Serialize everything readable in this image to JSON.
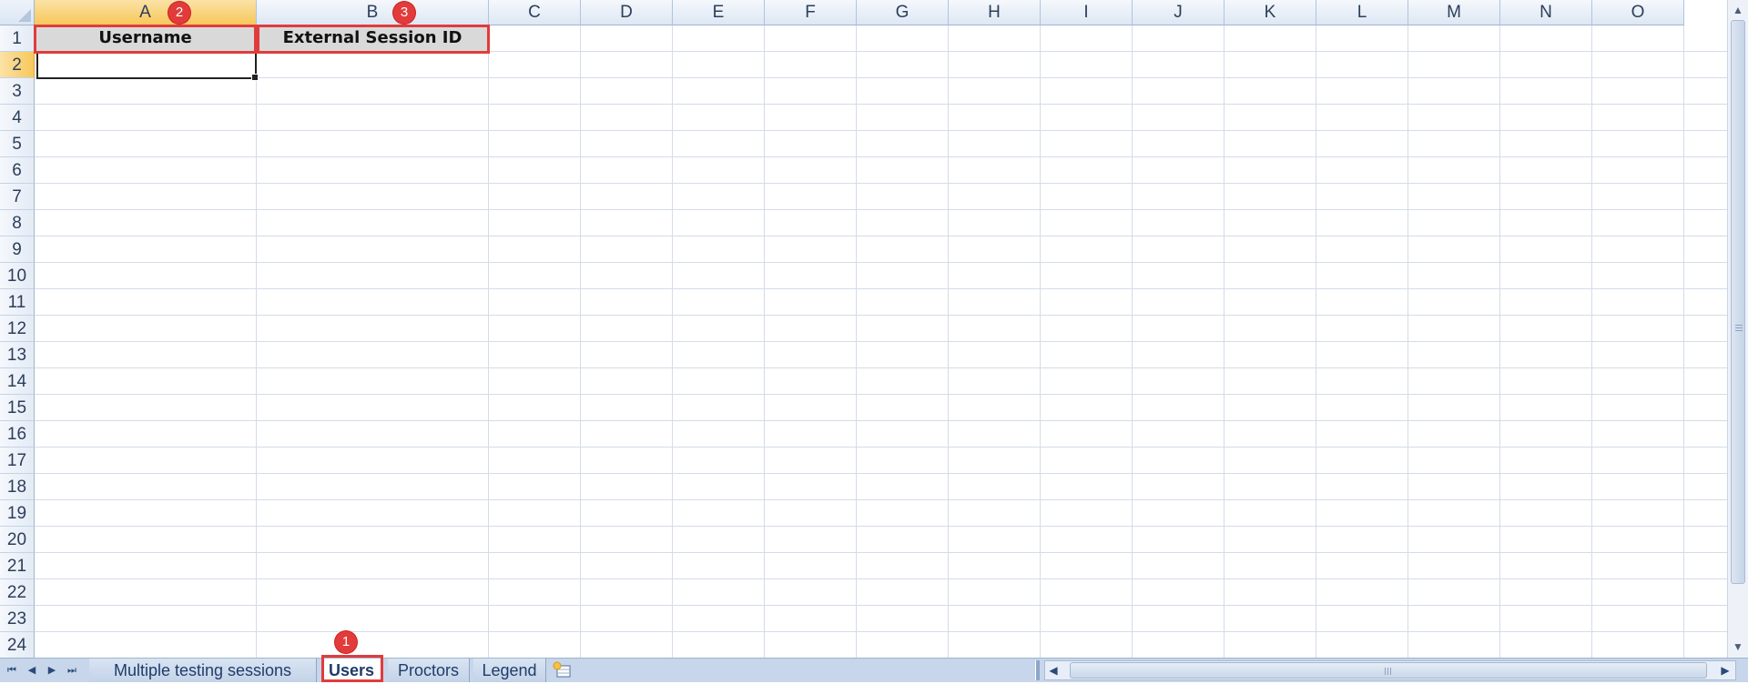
{
  "columns": [
    "A",
    "B",
    "C",
    "D",
    "E",
    "F",
    "G",
    "H",
    "I",
    "J",
    "K",
    "L",
    "M",
    "N",
    "O"
  ],
  "rows": [
    "1",
    "2",
    "3",
    "4",
    "5",
    "6",
    "7",
    "8",
    "9",
    "10",
    "11",
    "12",
    "13",
    "14",
    "15",
    "16",
    "17",
    "18",
    "19",
    "20",
    "21",
    "22",
    "23",
    "24"
  ],
  "selected_column": "A",
  "selected_row": "2",
  "header_row": {
    "A1": "Username",
    "B1": "External Session ID"
  },
  "active_cell": "A2",
  "sheet_tabs": [
    {
      "label": "Multiple testing sessions",
      "active": false
    },
    {
      "label": "Users",
      "active": true
    },
    {
      "label": "Proctors",
      "active": false
    },
    {
      "label": "Legend",
      "active": false
    }
  ],
  "annotations": {
    "badge_1": "1",
    "badge_2": "2",
    "badge_3": "3"
  },
  "colors": {
    "highlight": "#e03c3c",
    "selected_header": "#f7c85a",
    "header_cell_fill": "#d9d9d9"
  },
  "icons": {
    "first_sheet": "first-sheet-icon",
    "prev_sheet": "prev-sheet-icon",
    "next_sheet": "next-sheet-icon",
    "last_sheet": "last-sheet-icon",
    "insert_sheet": "insert-sheet-icon"
  }
}
